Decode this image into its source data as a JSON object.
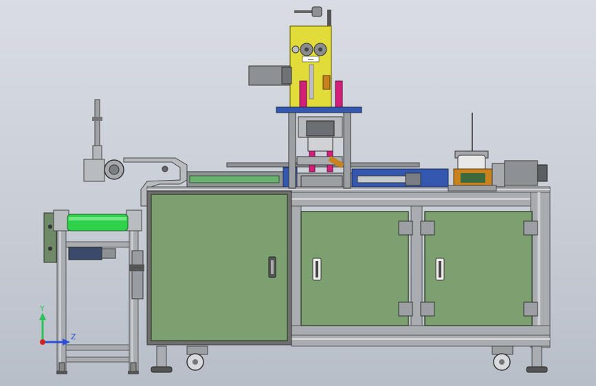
{
  "viewport": {
    "background_top": "#d9dde3",
    "background_bottom": "#b8bec8"
  },
  "triad": {
    "y_label": "Y",
    "z_label": "Z",
    "y_color": "#2ec25a",
    "z_color": "#2b4fd8",
    "origin_color": "#d42020"
  },
  "colors": {
    "cabinet_green": "#7da070",
    "frame_aluminum": "#a9adb2",
    "roller_green": "#2fd04a",
    "mechanism_yellow": "#e1dc3a",
    "motor_gray": "#8d9094",
    "accent_blue": "#3458b0",
    "accent_magenta": "#d0207a",
    "accent_brown": "#c8821e"
  }
}
